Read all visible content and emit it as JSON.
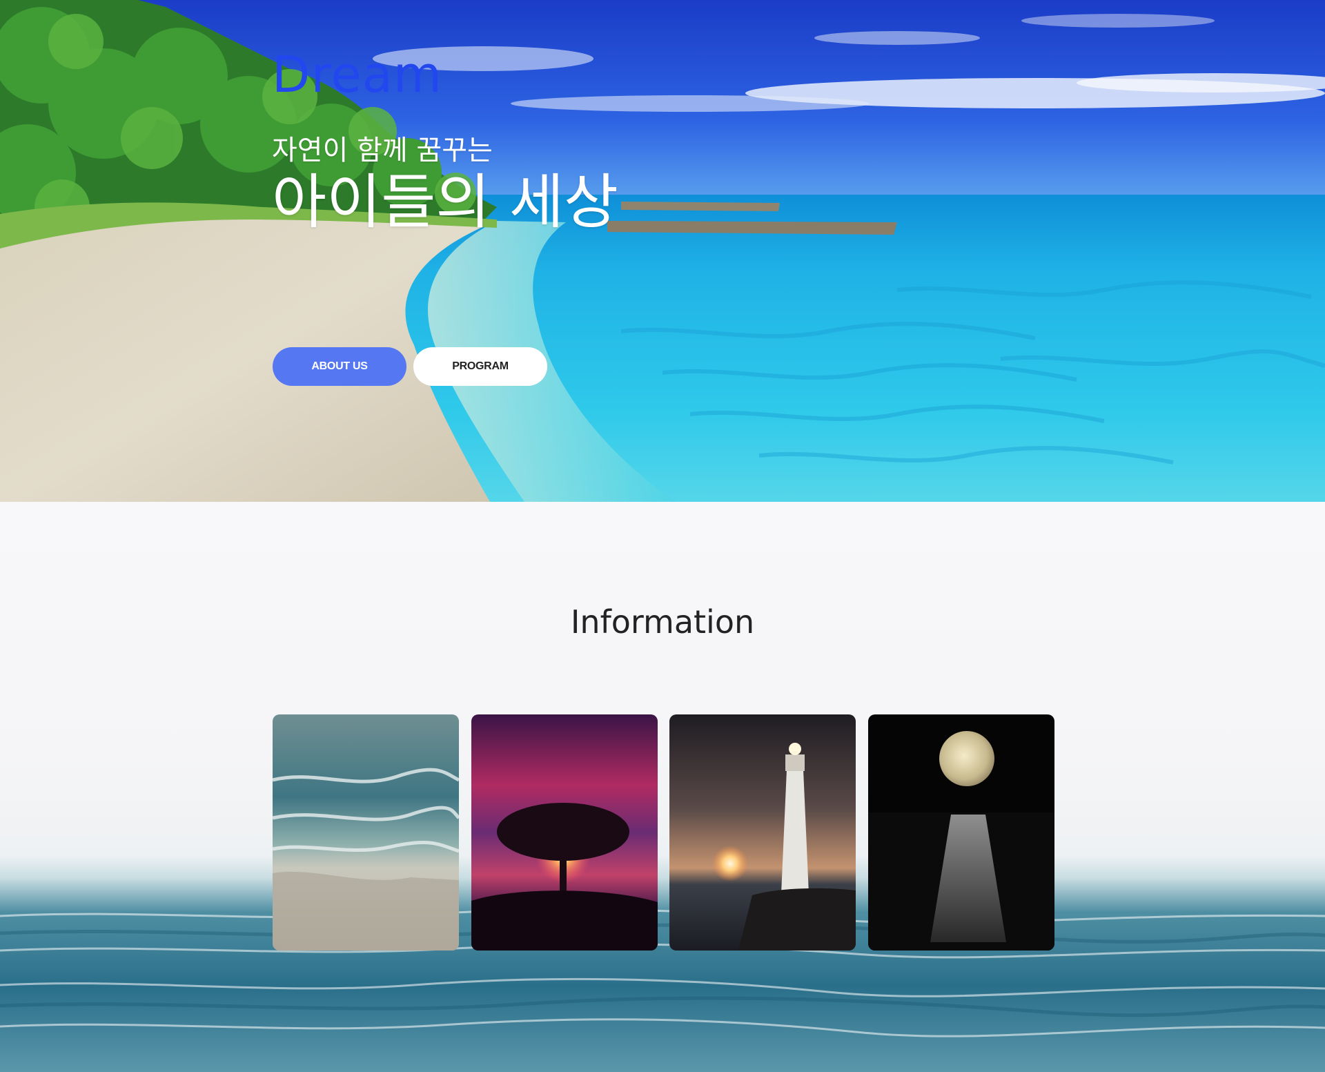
{
  "hero": {
    "brand": "Dream",
    "tagline_small": "자연이 함께 꿈꾸는",
    "tagline_big": "아이들의 세상",
    "buttons": {
      "about": "ABOUT US",
      "program": "PROGRAM"
    },
    "colors": {
      "brand": "#2347ee",
      "about_button": "#5577f2",
      "program_button": "#ffffff"
    }
  },
  "information": {
    "title": "Information",
    "cards": [
      {
        "image": "ocean-waves-beach"
      },
      {
        "image": "tree-sunset"
      },
      {
        "image": "lighthouse-sunset"
      },
      {
        "image": "moon-over-sea"
      }
    ]
  }
}
